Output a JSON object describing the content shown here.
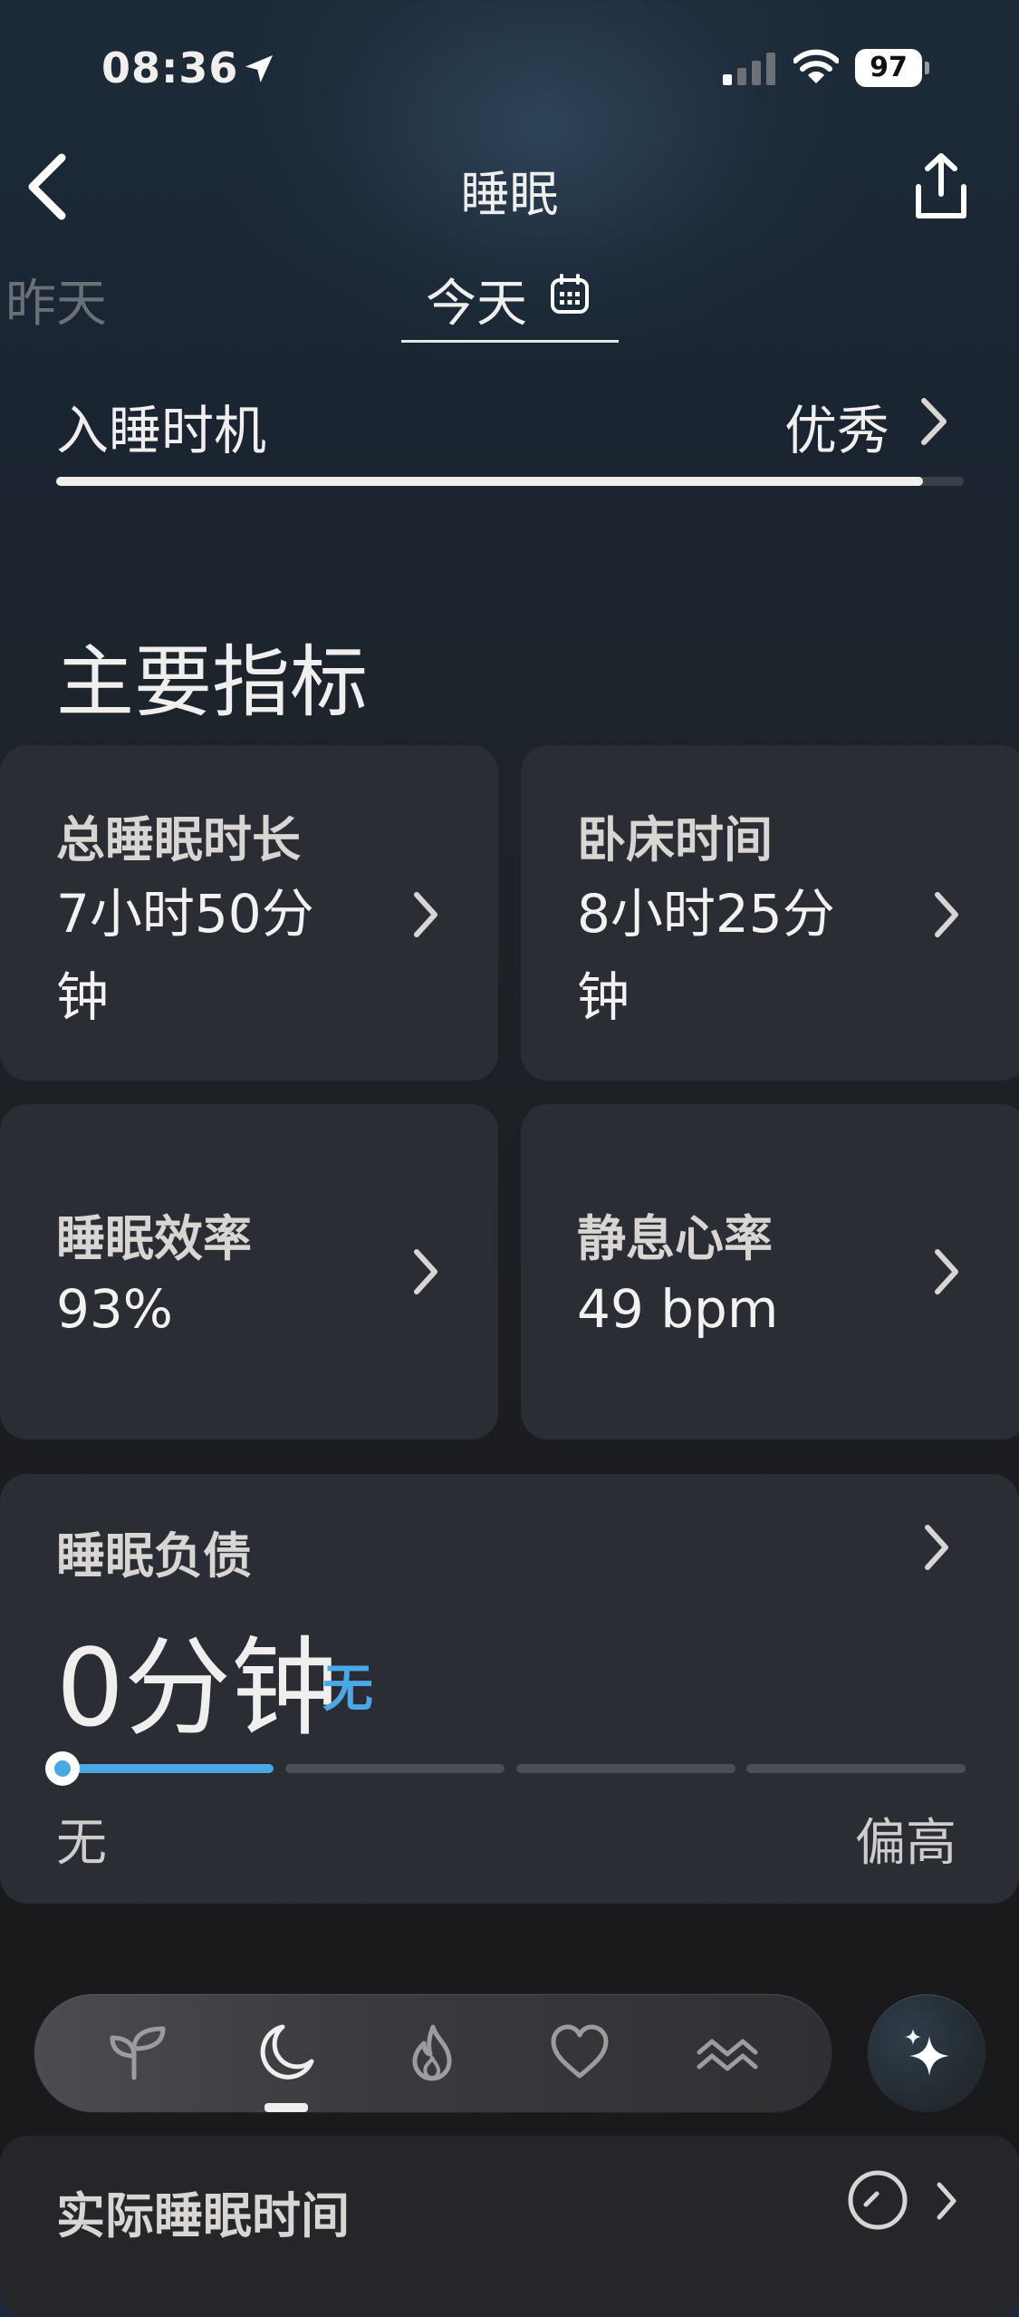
{
  "status_bar": {
    "time": "08:36",
    "battery": "97"
  },
  "nav": {
    "title": "睡眠"
  },
  "date_tabs": {
    "previous": "昨天",
    "current": "今天"
  },
  "sleep_timing": {
    "label": "入睡时机",
    "value": "优秀",
    "progress_fraction": 0.955
  },
  "section": {
    "title": "主要指标"
  },
  "metrics": [
    {
      "label": "总睡眠时长",
      "value": "7小时50分钟"
    },
    {
      "label": "卧床时间",
      "value": "8小时25分钟"
    },
    {
      "label": "睡眠效率",
      "value": "93%"
    },
    {
      "label": "静息心率",
      "value": "49 bpm"
    }
  ],
  "sleep_debt": {
    "label": "睡眠负债",
    "value": "0分钟",
    "level": "无",
    "scale_min": "无",
    "scale_max": "偏高",
    "level_index": 0,
    "accent_color": "#4aa7e4"
  },
  "tab_bar": {
    "tabs": [
      "sprout-icon",
      "moon-icon",
      "flame-icon",
      "heart-icon",
      "waves-icon"
    ],
    "selected_index": 1,
    "action": "sparkle-icon"
  },
  "next_card": {
    "label": "实际睡眠时间"
  }
}
